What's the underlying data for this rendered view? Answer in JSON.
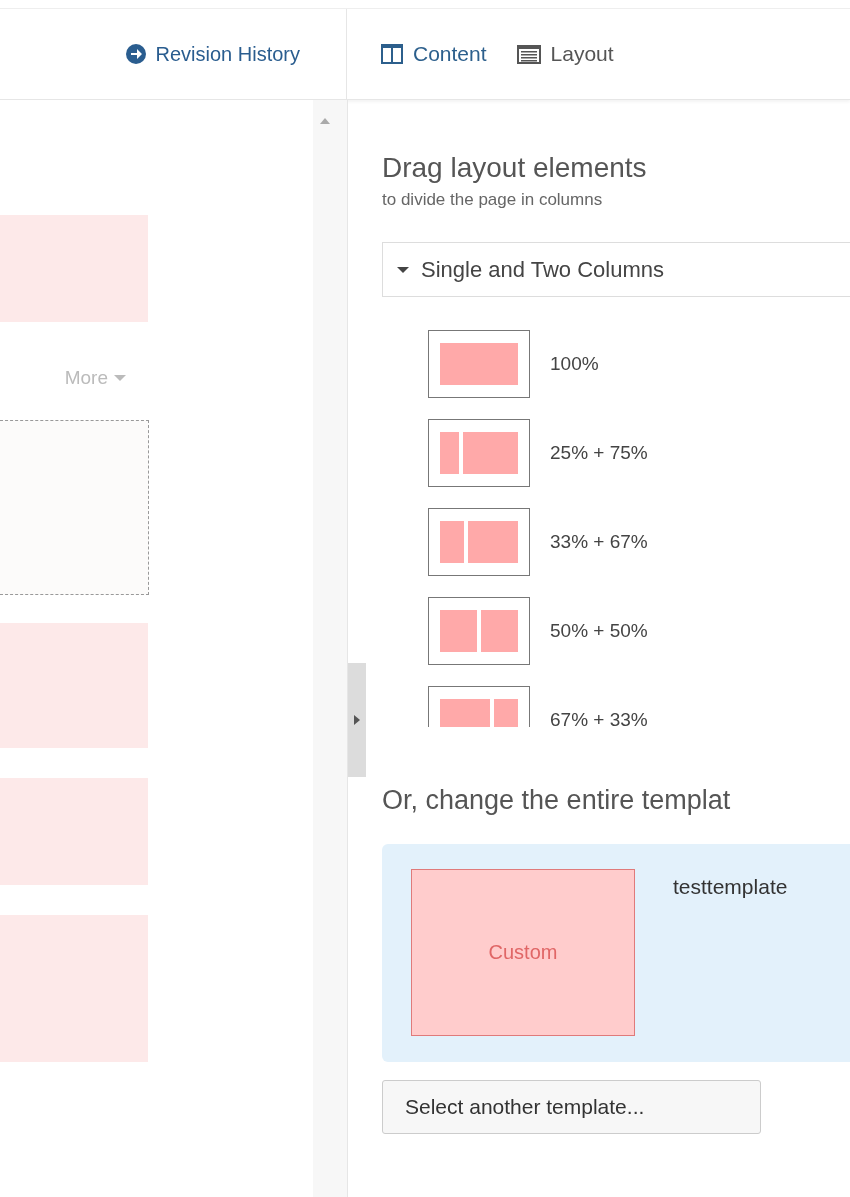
{
  "header": {
    "history_link": "Revision History",
    "tabs": [
      {
        "label": "Content",
        "kind": "columns"
      },
      {
        "label": "Layout",
        "kind": "list"
      }
    ]
  },
  "canvas": {
    "more_button": "More"
  },
  "layout_panel": {
    "title": "Drag layout elements",
    "subtitle": "to divide the page in columns",
    "group": {
      "label": "Single and Two Columns",
      "expanded": true,
      "items": [
        {
          "label": "100%",
          "kind": "full"
        },
        {
          "label": "25% + 75%",
          "kind": "quarter"
        },
        {
          "label": "33% + 67%",
          "kind": "third"
        },
        {
          "label": "50% + 50%",
          "kind": "half"
        },
        {
          "label": "67% + 33%",
          "kind": "twothirds"
        }
      ]
    }
  },
  "template_panel": {
    "title": "Or, change the entire templat",
    "template": {
      "thumbnail_label": "Custom",
      "name": "testtemplate"
    },
    "button": "Select another template..."
  }
}
